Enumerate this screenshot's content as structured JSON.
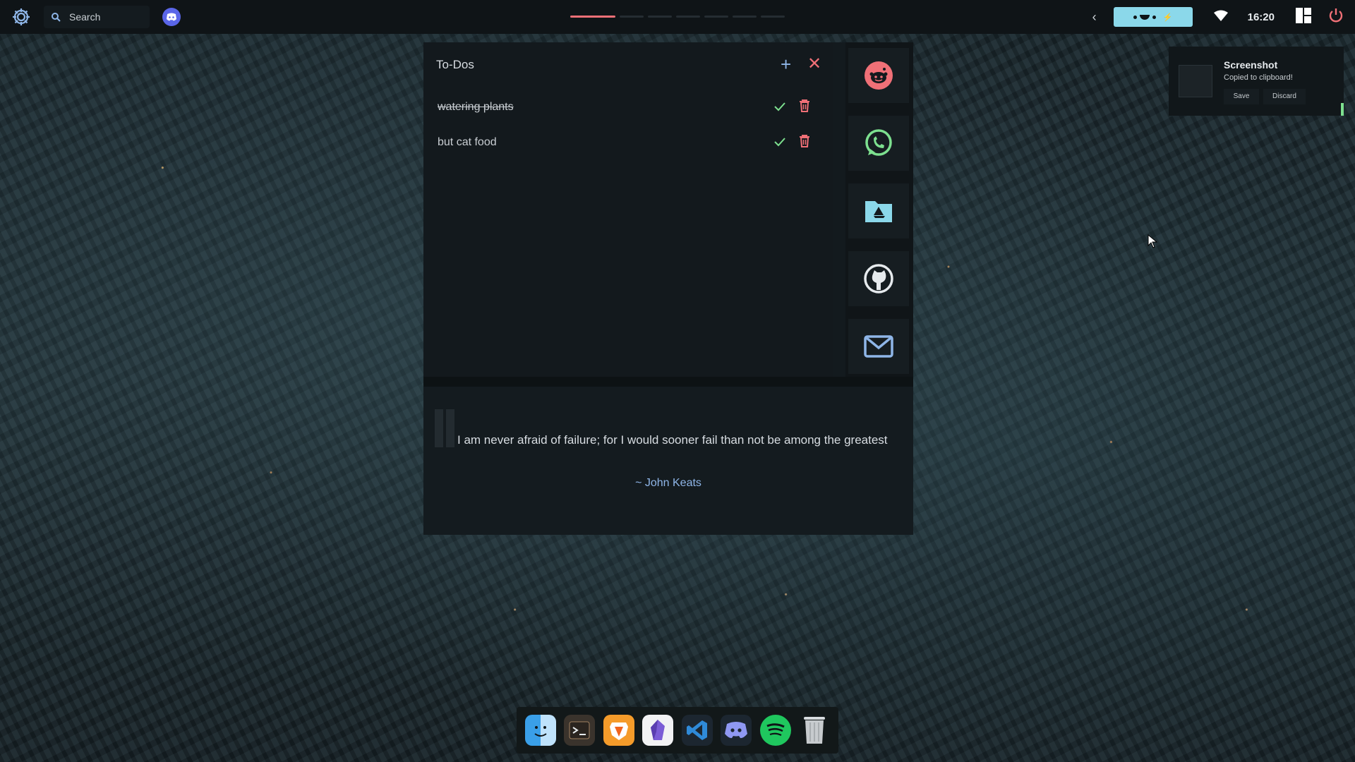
{
  "topbar": {
    "search_label": "Search",
    "time": "16:20",
    "workspaces": [
      true,
      false,
      false,
      false,
      false,
      false,
      false
    ]
  },
  "todo": {
    "title": "To-Dos",
    "items": [
      {
        "text": "watering plants",
        "done": true
      },
      {
        "text": "but cat food",
        "done": false
      }
    ]
  },
  "apps": [
    "reddit-icon",
    "whatsapp-icon",
    "google-drive-icon",
    "github-icon",
    "gmail-icon"
  ],
  "quote": {
    "text": "I am never afraid of failure; for I would sooner fail than not be among the greatest",
    "author": "~ John Keats"
  },
  "notification": {
    "title": "Screenshot",
    "body": "Copied to clipboard!",
    "save_label": "Save",
    "discard_label": "Discard"
  },
  "dock": [
    "finder-icon",
    "terminal-icon",
    "brave-icon",
    "obsidian-icon",
    "vscode-icon",
    "discord-icon",
    "spotify-icon",
    "trash-icon"
  ],
  "colors": {
    "accent_blue": "#8fb6e8",
    "accent_red": "#f07077",
    "accent_green": "#7de08f",
    "pill": "#8bd8ea"
  }
}
